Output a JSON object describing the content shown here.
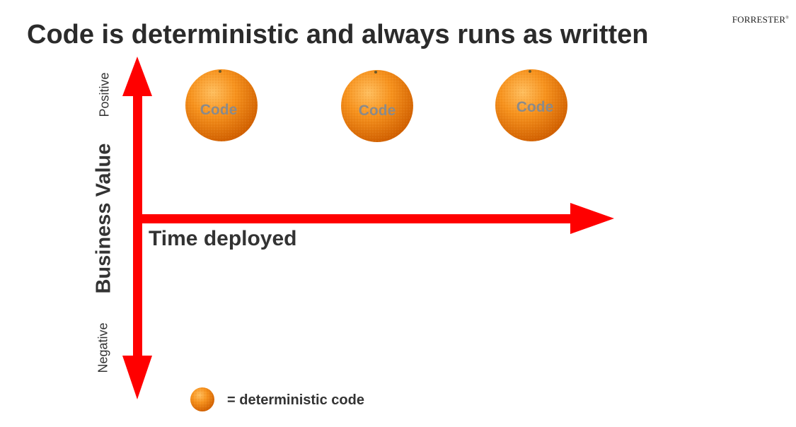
{
  "brand": {
    "name": "FORRESTER",
    "mark": "®"
  },
  "title": "Code is deterministic and always runs as written",
  "axes": {
    "y_label": "Business Value",
    "y_positive": "Positive",
    "y_negative": "Negative",
    "x_label": "Time deployed"
  },
  "items": [
    {
      "label": "Code",
      "icon": "orange-fruit-icon"
    },
    {
      "label": "Code",
      "icon": "orange-fruit-icon"
    },
    {
      "label": "Code",
      "icon": "orange-fruit-icon"
    }
  ],
  "legend": {
    "text": "= deterministic code",
    "icon": "orange-fruit-icon"
  },
  "colors": {
    "arrow": "#ff0000",
    "orange_light": "#ffb347",
    "orange": "#f7931e",
    "orange_dark": "#d96a00",
    "item_label": "#8a8a8a",
    "text": "#333333"
  }
}
